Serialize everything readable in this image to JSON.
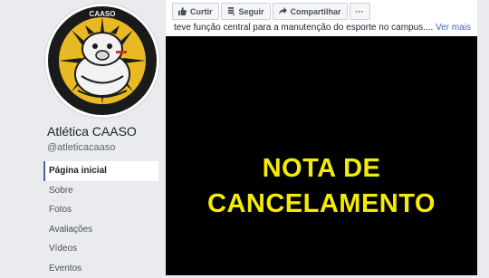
{
  "page": {
    "name": "Atlética CAASO",
    "handle": "@atleticacaaso"
  },
  "sidebar": {
    "items": [
      {
        "label": "Página inicial",
        "active": true
      },
      {
        "label": "Sobre"
      },
      {
        "label": "Fotos"
      },
      {
        "label": "Avaliações"
      },
      {
        "label": "Vídeos"
      },
      {
        "label": "Eventos"
      }
    ]
  },
  "post": {
    "actions": {
      "like": "Curtir",
      "follow": "Seguir",
      "share": "Compartilhar",
      "more": "···"
    },
    "text": "teve função central para a manutenção do esporte no campus....",
    "see_more": "Ver mais",
    "image": {
      "line1": "NOTA DE",
      "line2": "CANCELAMENTO",
      "text_color": "#f4ed00",
      "background": "#000000"
    }
  },
  "colors": {
    "accent": "#4267b2",
    "background": "#e9ebee"
  },
  "icons": [
    "thumbs-up-icon",
    "follow-icon",
    "share-icon",
    "more-icon"
  ]
}
